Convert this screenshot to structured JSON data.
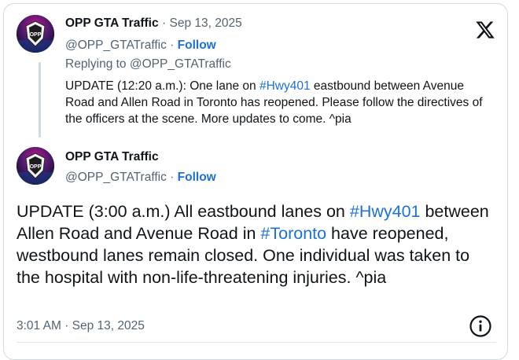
{
  "reply_tweet": {
    "display_name": "OPP GTA Traffic",
    "date": "· Sep 13, 2025",
    "handle": "@OPP_GTATraffic",
    "separator": "·",
    "follow_label": "Follow",
    "replying_to": "Replying to @OPP_GTATraffic",
    "text_before_hashtag": "UPDATE (12:20 a.m.): One lane on ",
    "hashtag": "#Hwy401",
    "text_after_hashtag": " eastbound between Avenue Road and Allen Road in Toronto has reopened. Please follow the directives of the officers at the scene. More updates to come. ^pia"
  },
  "main_tweet": {
    "display_name": "OPP GTA Traffic",
    "handle": "@OPP_GTATraffic",
    "separator": "·",
    "follow_label": "Follow",
    "text_part1": "UPDATE (3:00 a.m.) All eastbound lanes on ",
    "hashtag1": "#Hwy401",
    "text_part2": " between Allen Road and Avenue Road in ",
    "hashtag2": "#Toronto",
    "text_part3": " have reopened, westbound lanes remain closed. One individual was taken to the hospital with non-life-threatening injuries. ^pia",
    "timestamp": "3:01 AM · Sep 13, 2025"
  },
  "avatar_text": "OPP",
  "icons": {
    "platform_logo": "x-logo-icon",
    "info": "info-icon"
  },
  "colors": {
    "link": "#1d70d6",
    "secondary_text": "#536471",
    "primary_text": "#0f1419",
    "border": "#cfd9de"
  }
}
